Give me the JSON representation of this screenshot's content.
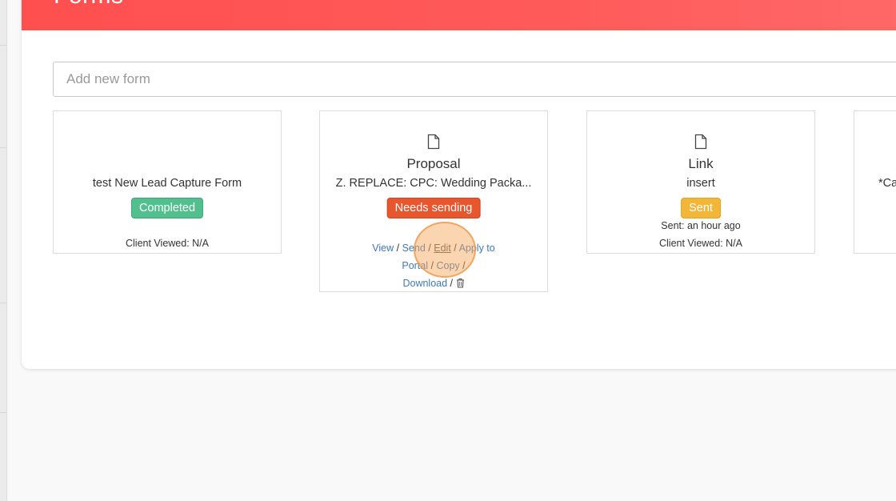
{
  "page": {
    "title": "Forms"
  },
  "add_form": {
    "placeholder": "Add new form"
  },
  "cards": [
    {
      "type": "",
      "name": "test New Lead Capture Form",
      "status": "Completed",
      "status_color": "#52c08e",
      "client_viewed": "Client Viewed: N/A"
    },
    {
      "type": "Proposal",
      "name": "Z. REPLACE: CPC: Wedding Packa...",
      "status": "Needs sending",
      "status_color": "#e8562d",
      "actions": {
        "view": "View",
        "send": "Send",
        "edit": "Edit",
        "apply_portal_1": "Apply to",
        "apply_portal_2": "Portal",
        "copy": "Copy",
        "download": "Download",
        "separator": "/",
        "delete_icon": "trash-icon"
      }
    },
    {
      "type": "Link",
      "name": "insert",
      "status": "Sent",
      "status_color": "#f4b637",
      "sent": "Sent: an hour ago",
      "client_viewed": "Client Viewed: N/A"
    },
    {
      "name": "*Ca"
    }
  ],
  "colors": {
    "header": "#ff5252",
    "link": "#3d7ab8"
  }
}
